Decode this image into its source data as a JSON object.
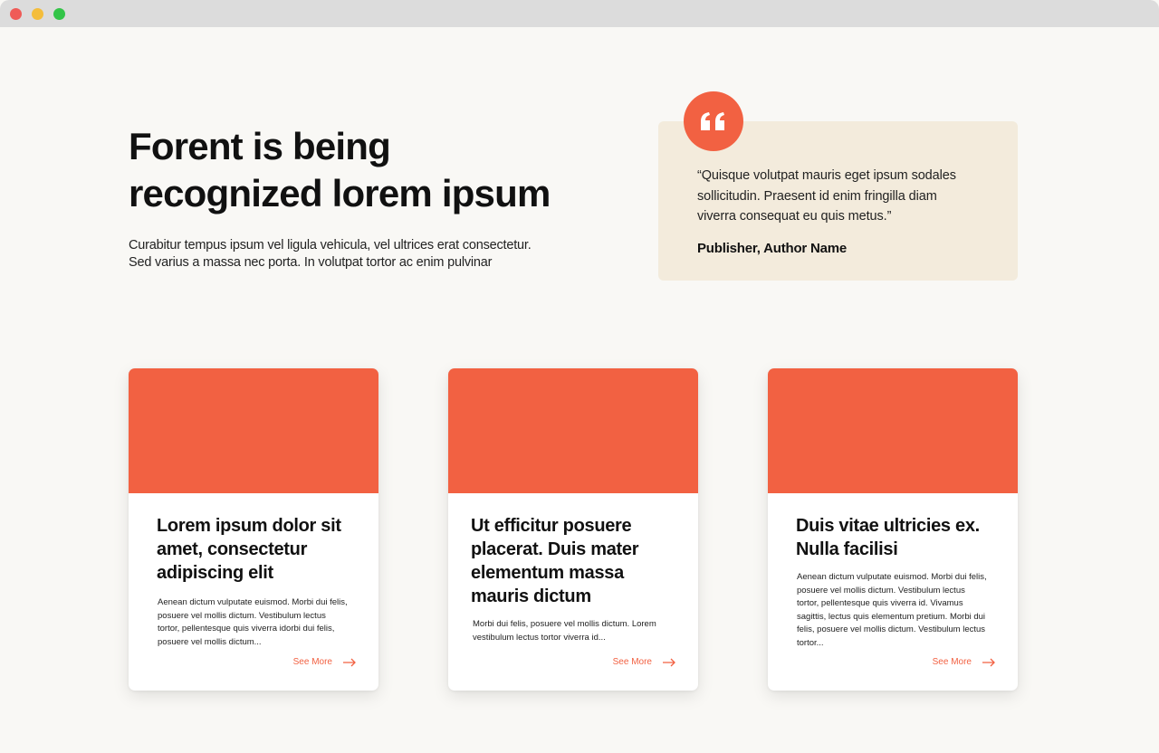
{
  "window": {
    "controls": [
      "close",
      "minimize",
      "maximize"
    ]
  },
  "hero": {
    "title_line1": "Forent is being",
    "title_line2": "recognized lorem ipsum",
    "subtitle_line1": "Curabitur tempus ipsum vel ligula vehicula, vel ultrices erat consectetur.",
    "subtitle_line2": "Sed varius a massa nec porta. In volutpat tortor ac enim pulvinar"
  },
  "quote": {
    "icon": "quote-icon",
    "text_line1": "“Quisque volutpat mauris eget ipsum sodales",
    "text_line2": "sollicitudin. Praesent id enim fringilla diam",
    "text_line3": "viverra consequat eu quis metus.”",
    "author": "Publisher, Author Name"
  },
  "colors": {
    "accent": "#f26142",
    "quote_bg": "#f3ebdc",
    "page_bg": "#f9f8f5"
  },
  "cards": [
    {
      "title_lines": [
        "Lorem ipsum dolor sit",
        "amet, consectetur",
        "adipiscing elit"
      ],
      "desc_lines": [
        "Aenean dictum vulputate euismod. Morbi dui felis,",
        "posuere vel mollis dictum. Vestibulum lectus",
        "tortor, pellentesque quis viverra idorbi dui felis,",
        "posuere vel mollis dictum..."
      ],
      "link": "See More"
    },
    {
      "title_lines": [
        "Ut efficitur posuere",
        "placerat. Duis mater",
        "elementum massa",
        "mauris dictum"
      ],
      "desc_lines": [
        "Morbi dui felis, posuere vel mollis dictum.  Lorem",
        "vestibulum lectus tortor viverra id..."
      ],
      "link": "See More"
    },
    {
      "title_lines": [
        "Duis vitae ultricies ex.",
        "Nulla facilisi"
      ],
      "desc_lines": [
        "Aenean dictum vulputate euismod. Morbi dui felis,",
        "posuere vel mollis dictum. Vestibulum lectus",
        "tortor, pellentesque quis viverra id. Vivamus",
        "sagittis, lectus quis elementum pretium. Morbi dui",
        "felis, posuere vel mollis dictum. Vestibulum lectus",
        "tortor..."
      ],
      "link": "See More"
    }
  ]
}
